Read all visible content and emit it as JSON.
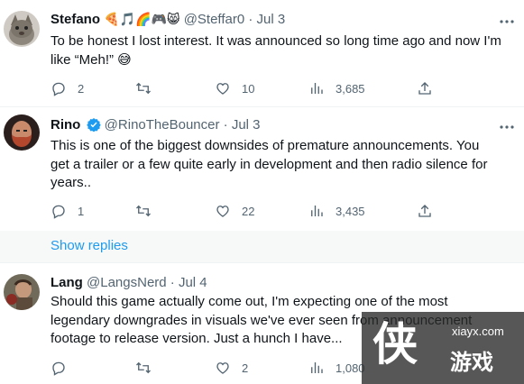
{
  "colors": {
    "text": "#0f1419",
    "secondary": "#536471",
    "accent": "#1d9bf0",
    "show_replies_bg": "#f7f9f9"
  },
  "tweets": [
    {
      "name": "Stefano",
      "name_emoji": "🍕🎵🌈🎮😸",
      "handle": "@Steffar0",
      "separator": "·",
      "date": "Jul 3",
      "text_lines": [
        "To be honest I lost interest. It was announced so long time ago and now I'm",
        "like “Meh!” 😅"
      ],
      "verified": false,
      "actions": {
        "replies": "2",
        "retweets": "",
        "likes": "10",
        "views": "3,685"
      },
      "avatar_icon": "avatar-cat-photo"
    },
    {
      "name": "Rino",
      "handle": "@RinoTheBouncer",
      "separator": "·",
      "date": "Jul 3",
      "text_lines": [
        "This is one of the biggest downsides of premature announcements. You",
        "get a trailer or a few quite early in development and then radio silence for",
        "years.."
      ],
      "verified": true,
      "actions": {
        "replies": "1",
        "retweets": "",
        "likes": "22",
        "views": "3,435"
      },
      "avatar_icon": "avatar-bearded-man"
    },
    {
      "name": "Lang",
      "handle": "@LangsNerd",
      "separator": "·",
      "date": "Jul 4",
      "text_lines": [
        "Should this game actually come out, I'm expecting one of the most",
        "legendary downgrades in visuals we've ever seen from announcement",
        "footage to release version. Just a hunch I have..."
      ],
      "verified": false,
      "actions": {
        "replies": "",
        "retweets": "",
        "likes": "2",
        "views": "1,080"
      },
      "avatar_icon": "avatar-fighter-photo"
    }
  ],
  "show_replies": "Show replies",
  "watermark": {
    "glyph": "侠",
    "url": "xiayx.com",
    "name": "游戏"
  },
  "icons": {
    "reply": "reply-icon",
    "retweet": "retweet-icon",
    "like": "heart-icon",
    "views": "views-chart-icon",
    "share": "share-icon",
    "more": "more-dots-icon"
  }
}
